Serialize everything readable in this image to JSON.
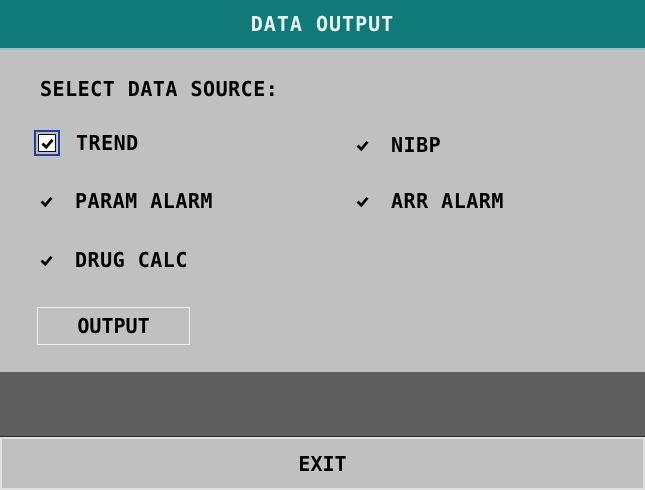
{
  "title": "DATA OUTPUT",
  "prompt": "SELECT DATA SOURCE:",
  "options": [
    {
      "label": "TREND",
      "checked": true,
      "focused": true
    },
    {
      "label": "NIBP",
      "checked": true
    },
    {
      "label": "PARAM ALARM",
      "checked": true
    },
    {
      "label": "ARR ALARM",
      "checked": true
    },
    {
      "label": "DRUG CALC",
      "checked": true
    }
  ],
  "output_label": "OUTPUT",
  "status_text": "",
  "exit_label": "EXIT",
  "colors": {
    "title_bar": "#0f7a78",
    "background": "#c0c0c0",
    "status_panel": "#5e5e5e",
    "focus_border": "#1f3fa0"
  },
  "icons": {
    "check": "check-mark-icon"
  }
}
